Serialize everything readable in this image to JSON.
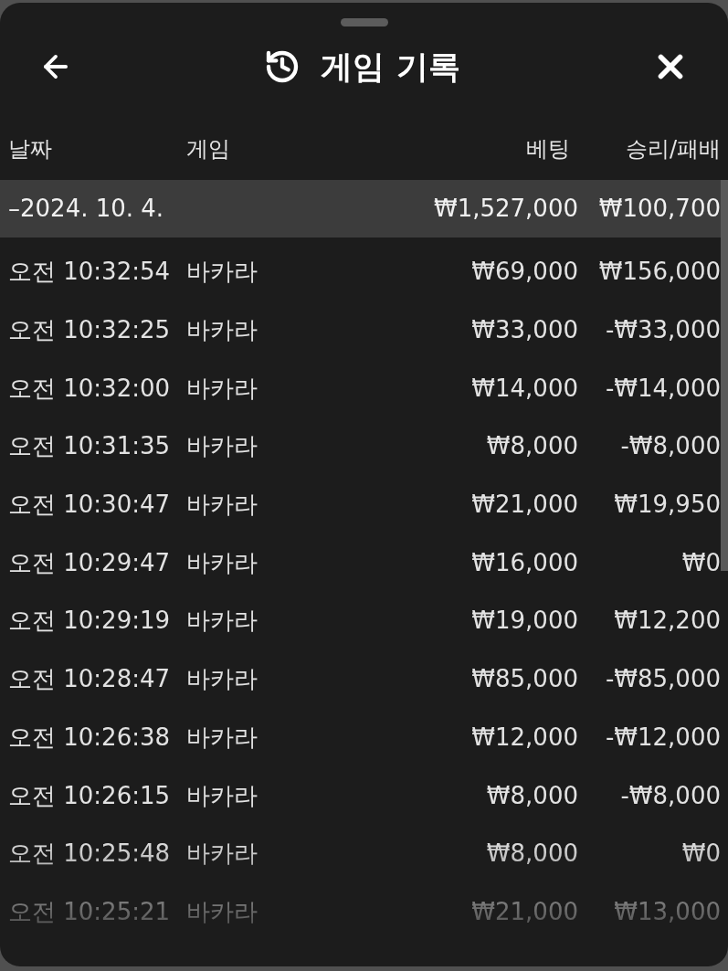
{
  "header": {
    "title": "게임 기록"
  },
  "columns": [
    "날짜",
    "게임",
    "베팅",
    "승리/패배"
  ],
  "groups": [
    {
      "date": "–2024. 10. 4.",
      "bet": "₩1,527,000",
      "result": "₩100,700",
      "expanded": true,
      "rows": [
        {
          "time": "오전 10:32:54",
          "game": "바카라",
          "bet": "₩69,000",
          "result": "₩156,000"
        },
        {
          "time": "오전 10:32:25",
          "game": "바카라",
          "bet": "₩33,000",
          "result": "-₩33,000"
        },
        {
          "time": "오전 10:32:00",
          "game": "바카라",
          "bet": "₩14,000",
          "result": "-₩14,000"
        },
        {
          "time": "오전 10:31:35",
          "game": "바카라",
          "bet": "₩8,000",
          "result": "-₩8,000"
        },
        {
          "time": "오전 10:30:47",
          "game": "바카라",
          "bet": "₩21,000",
          "result": "₩19,950"
        },
        {
          "time": "오전 10:29:47",
          "game": "바카라",
          "bet": "₩16,000",
          "result": "₩0"
        },
        {
          "time": "오전 10:29:19",
          "game": "바카라",
          "bet": "₩19,000",
          "result": "₩12,200"
        },
        {
          "time": "오전 10:28:47",
          "game": "바카라",
          "bet": "₩85,000",
          "result": "-₩85,000"
        },
        {
          "time": "오전 10:26:38",
          "game": "바카라",
          "bet": "₩12,000",
          "result": "-₩12,000"
        },
        {
          "time": "오전 10:26:15",
          "game": "바카라",
          "bet": "₩8,000",
          "result": "-₩8,000"
        },
        {
          "time": "오전 10:25:48",
          "game": "바카라",
          "bet": "₩8,000",
          "result": "₩0"
        },
        {
          "time": "오전 10:25:21",
          "game": "바카라",
          "bet": "₩21,000",
          "result": "₩13,000"
        }
      ]
    }
  ]
}
